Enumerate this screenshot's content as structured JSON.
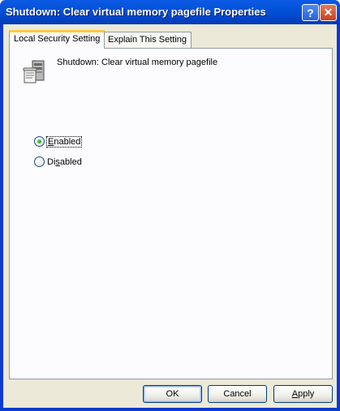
{
  "window": {
    "title": "Shutdown: Clear virtual memory pagefile Properties",
    "help_glyph": "?",
    "close_glyph": "✕"
  },
  "tabs": [
    {
      "label": "Local Security Setting",
      "active": true
    },
    {
      "label": "Explain This Setting",
      "active": false
    }
  ],
  "policy": {
    "icon": "security-policy-icon",
    "name": "Shutdown: Clear virtual memory pagefile"
  },
  "options": [
    {
      "first": "E",
      "rest": "nabled",
      "checked": true
    },
    {
      "first": "Di",
      "mid": "s",
      "rest": "abled",
      "checked": false
    }
  ],
  "buttons": {
    "ok": "OK",
    "cancel": "Cancel",
    "apply_first": "A",
    "apply_rest": "pply"
  }
}
